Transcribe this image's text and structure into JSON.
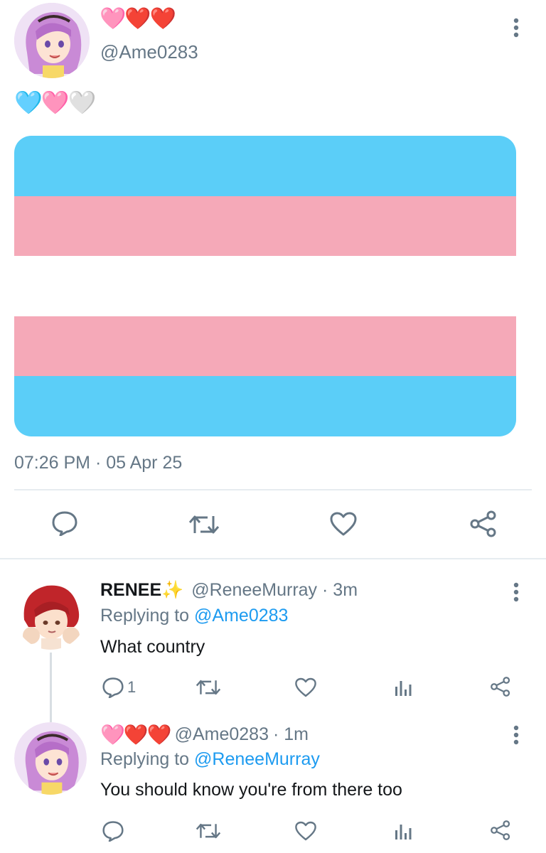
{
  "main_tweet": {
    "name_emojis": "🩷❤️❤️",
    "handle": "@Ame0283",
    "body_emojis": "🩵🩷🤍",
    "flag_colors": [
      "#5bcef8",
      "#f5a9b8",
      "#ffffff",
      "#f5a9b8",
      "#5bcef8"
    ],
    "timestamp": "07:26 PM · 05 Apr 25"
  },
  "reply_1": {
    "display_name": "RENEE✨",
    "handle": "@ReneeMurray",
    "time": "· 3m",
    "replying_label": "Replying to",
    "replying_to": "@Ame0283",
    "text": "What country",
    "reply_count": "1"
  },
  "reply_2": {
    "name_emojis": "🩷❤️❤️",
    "handle": "@Ame0283",
    "time": "· 1m",
    "replying_label": "Replying to",
    "replying_to": "@ReneeMurray",
    "text": "You should know you're from there too"
  },
  "icons": {
    "reply": "speech-bubble-icon",
    "retweet": "retweet-icon",
    "like": "heart-outline-icon",
    "share": "share-icon",
    "stats": "bar-chart-icon",
    "more": "vertical-dots-icon"
  },
  "colors": {
    "accent": "#1d9bf0",
    "muted": "#657786",
    "flag_blue": "#5bcef8",
    "flag_pink": "#f5a9b8"
  }
}
